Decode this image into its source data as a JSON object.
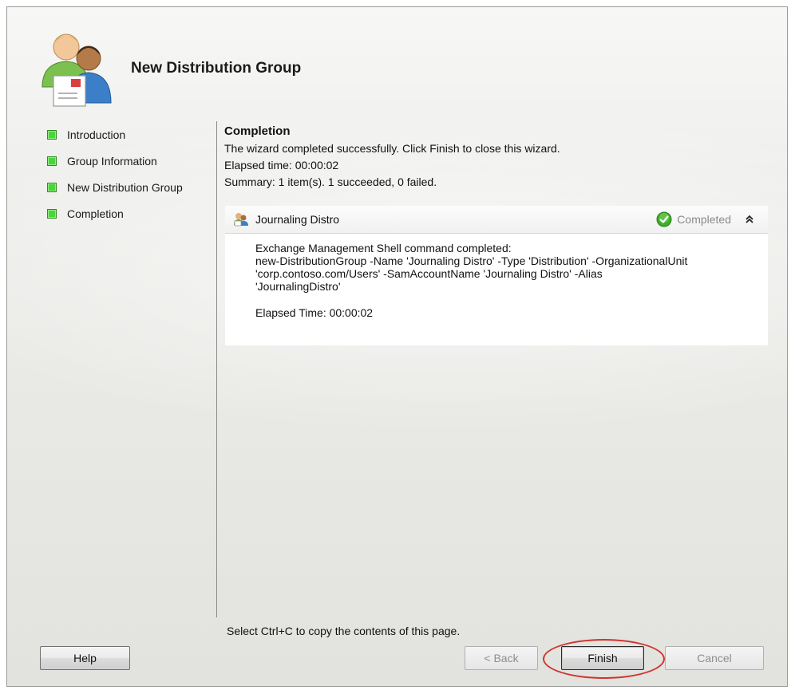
{
  "wizard": {
    "title": "New Distribution Group",
    "icon": "distribution-group-users-icon"
  },
  "steps": [
    {
      "label": "Introduction",
      "status": "complete"
    },
    {
      "label": "Group Information",
      "status": "complete"
    },
    {
      "label": "New Distribution Group",
      "status": "complete"
    },
    {
      "label": "Completion",
      "status": "complete"
    }
  ],
  "completion": {
    "heading": "Completion",
    "message": "The wizard completed successfully. Click Finish to close this wizard.",
    "elapsed": "Elapsed time: 00:00:02",
    "summary": "Summary: 1 item(s). 1 succeeded, 0 failed."
  },
  "item": {
    "name": "Journaling Distro",
    "status": "Completed",
    "command_line1": "Exchange Management Shell command completed:",
    "command_line2": "new-DistributionGroup -Name 'Journaling Distro' -Type 'Distribution' -OrganizationalUnit",
    "command_line3": "'corp.contoso.com/Users' -SamAccountName 'Journaling Distro' -Alias",
    "command_line4": "'JournalingDistro'",
    "elapsed": "Elapsed Time: 00:00:02"
  },
  "hint": "Select Ctrl+C to copy the contents of this page.",
  "buttons": {
    "help": "Help",
    "back": "< Back",
    "finish": "Finish",
    "cancel": "Cancel"
  },
  "colors": {
    "step_complete": "#4cd43c",
    "highlight_ring": "#d0342c",
    "status_success": "#3fae2a"
  }
}
